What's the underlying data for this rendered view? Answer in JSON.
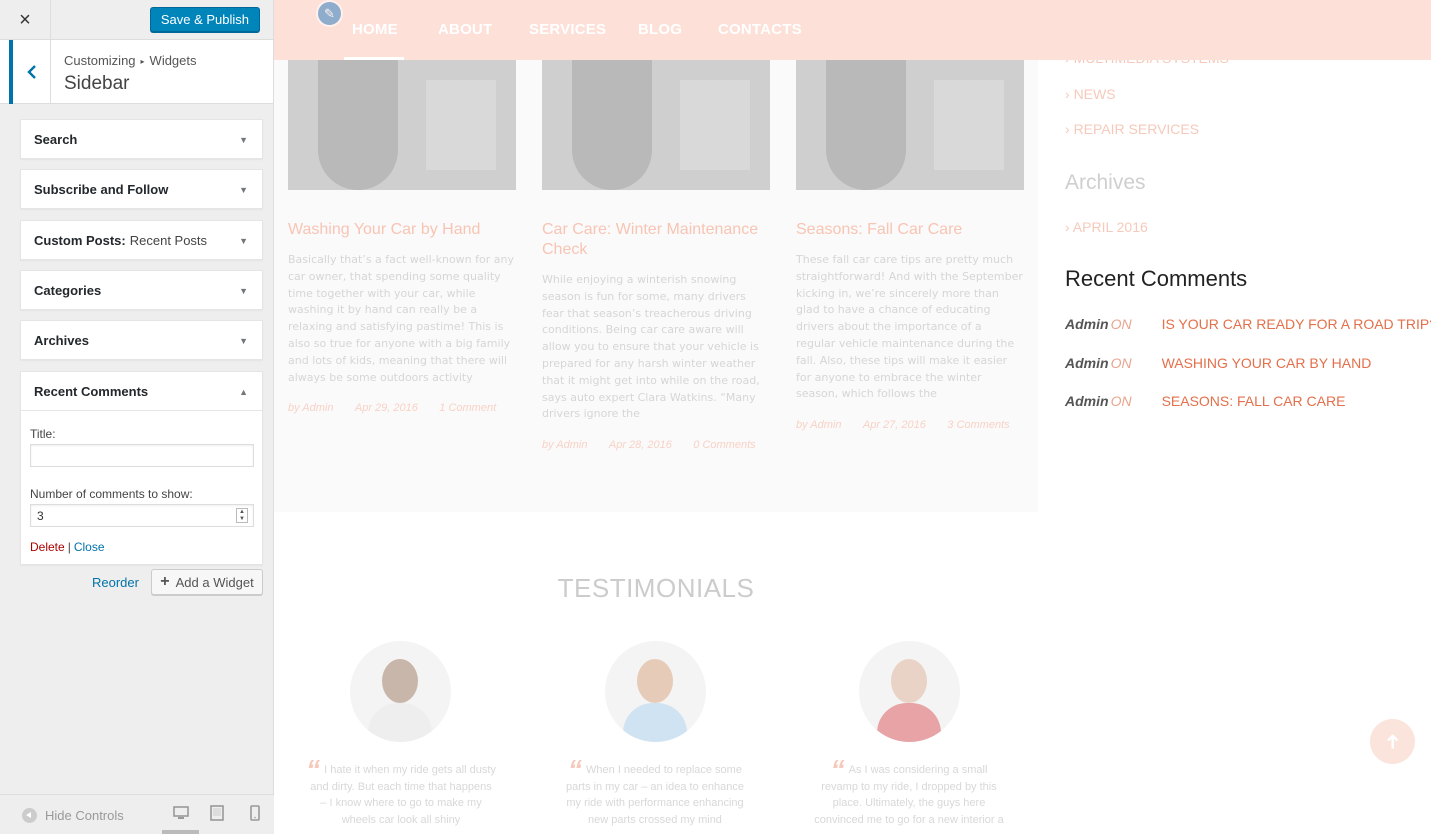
{
  "panel": {
    "close_icon": "×",
    "save_label": "Save & Publish",
    "breadcrumb": [
      "Customizing",
      "Widgets"
    ],
    "section_title": "Sidebar",
    "widgets": [
      {
        "title": "Search",
        "sub": ""
      },
      {
        "title": "Subscribe and Follow",
        "sub": ""
      },
      {
        "title": "Custom Posts:",
        "sub": "Recent Posts"
      },
      {
        "title": "Categories",
        "sub": ""
      },
      {
        "title": "Archives",
        "sub": ""
      },
      {
        "title": "Recent Comments",
        "sub": ""
      }
    ],
    "recent_comments_form": {
      "title_label": "Title:",
      "title_value": "",
      "count_label": "Number of comments to show:",
      "count_value": "3",
      "delete_label": "Delete",
      "separator": "|",
      "close_label": "Close"
    },
    "reorder_label": "Reorder",
    "add_widget_label": "Add a Widget",
    "hide_controls_label": "Hide Controls",
    "devices": [
      "desktop",
      "tablet",
      "mobile"
    ]
  },
  "preview": {
    "nav": [
      "HOME",
      "ABOUT",
      "SERVICES",
      "BLOG",
      "CONTACTS"
    ],
    "posts": [
      {
        "title": "Washing Your Car by Hand",
        "excerpt": "Basically that’s a fact well-known for any car owner, that spending some quality time together with your car, while washing it by hand can really be a relaxing and satisfying pastime! This is also so true for anyone with a big family and lots of kids, meaning that there will always be some outdoors activity",
        "author": "by Admin",
        "date": "Apr 29, 2016",
        "comments": "1 Comment"
      },
      {
        "title": "Car Care: Winter Maintenance Check",
        "excerpt": "While enjoying a winterish snowing season is fun for some, many drivers fear that season’s treacherous driving conditions. Being car care aware will allow you to ensure that your vehicle is prepared for any harsh winter weather that it might get into while on the road, says auto expert Clara Watkins. “Many drivers ignore the",
        "author": "by Admin",
        "date": "Apr 28, 2016",
        "comments": "0 Comments"
      },
      {
        "title": "Seasons: Fall Car Care",
        "excerpt": "These fall car care tips are pretty much straightforward! And with the September kicking in, we’re sincerely more than glad to have a chance of educating drivers about the importance of a regular vehicle maintenance during the fall. Also, these tips will make it easier for anyone to embrace the winter season, which follows the",
        "author": "by Admin",
        "date": "Apr 27, 2016",
        "comments": "3 Comments"
      }
    ],
    "sidebar": {
      "categories": [
        "MULTIMEDIA SYSTEMS",
        "NEWS",
        "REPAIR SERVICES"
      ],
      "archives_heading": "Archives",
      "archives": [
        "APRIL 2016"
      ],
      "recent_comments_heading": "Recent Comments",
      "recent_comments": [
        {
          "author": "Admin",
          "on": "ON",
          "post": "IS YOUR CAR READY FOR A ROAD TRIP?"
        },
        {
          "author": "Admin",
          "on": "ON",
          "post": "WASHING YOUR CAR BY HAND"
        },
        {
          "author": "Admin",
          "on": "ON",
          "post": "SEASONS: FALL CAR CARE"
        }
      ]
    },
    "testimonials_title": "TESTIMONIALS",
    "testimonials": [
      {
        "text": "I hate it when my ride gets all dusty and dirty. But each time that happens – I know where to go to make my wheels car look all shiny"
      },
      {
        "text": "When I needed to replace some parts in my car – an idea to enhance my ride with performance enhancing new parts crossed my mind"
      },
      {
        "text": "As I was considering a small revamp to my ride, I dropped by this place. Ultimately, the guys here convinced me to go for a new interior a"
      }
    ],
    "colors": {
      "accent": "#e3704b",
      "nav_bg": "#fde0d8",
      "panel_primary": "#0085ba"
    }
  }
}
